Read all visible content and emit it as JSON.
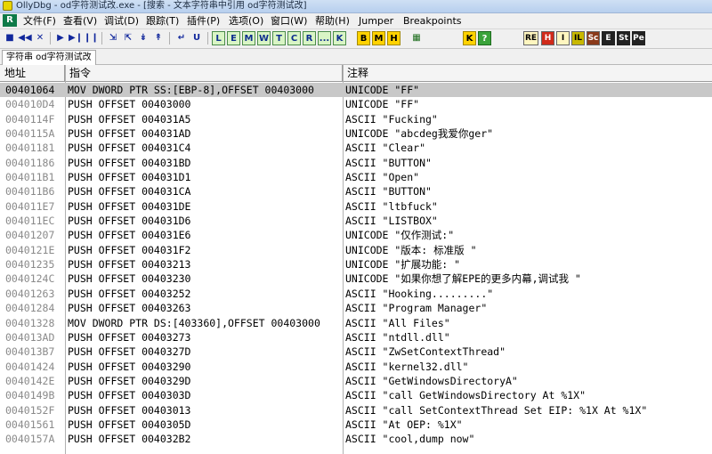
{
  "window": {
    "title": "OllyDbg - od字符测试改.exe - [搜索 - 文本字符串中引用 od字符测试改]"
  },
  "menubar": {
    "cpu_label": "R",
    "items": [
      "文件(F)",
      "查看(V)",
      "调试(D)",
      "跟踪(T)",
      "插件(P)",
      "选项(O)",
      "窗口(W)",
      "帮助(H)",
      "Jumper",
      "Breakpoints"
    ]
  },
  "toolbar": {
    "letters": [
      "L",
      "E",
      "M",
      "W",
      "T",
      "C",
      "R",
      "...",
      "K"
    ],
    "yellow": [
      "B",
      "M",
      "H"
    ],
    "k2": "K",
    "q": "?",
    "right": [
      "RE",
      "H",
      "I",
      "IL",
      "Sc",
      "E",
      "St",
      "Pe"
    ]
  },
  "tab": {
    "label": "字符串 od字符测试改"
  },
  "table": {
    "columns": [
      "地址",
      "指令",
      "注释"
    ],
    "rows": [
      {
        "addr": "00401064",
        "instr": "MOV DWORD PTR SS:[EBP-8],OFFSET 00403000",
        "note": "UNICODE \"FF\"",
        "selected": true
      },
      {
        "addr": "004010D4",
        "instr": "PUSH OFFSET 00403000",
        "note": "UNICODE \"FF\""
      },
      {
        "addr": "0040114F",
        "instr": "PUSH OFFSET 004031A5",
        "note": "ASCII \"Fucking\""
      },
      {
        "addr": "0040115A",
        "instr": "PUSH OFFSET 004031AD",
        "note": "UNICODE \"abcdeg我爱你ger\""
      },
      {
        "addr": "00401181",
        "instr": "PUSH OFFSET 004031C4",
        "note": "ASCII \"Clear\""
      },
      {
        "addr": "00401186",
        "instr": "PUSH OFFSET 004031BD",
        "note": "ASCII \"BUTTON\""
      },
      {
        "addr": "004011B1",
        "instr": "PUSH OFFSET 004031D1",
        "note": "ASCII \"Open\""
      },
      {
        "addr": "004011B6",
        "instr": "PUSH OFFSET 004031CA",
        "note": "ASCII \"BUTTON\""
      },
      {
        "addr": "004011E7",
        "instr": "PUSH OFFSET 004031DE",
        "note": "ASCII \"ltbfuck\""
      },
      {
        "addr": "004011EC",
        "instr": "PUSH OFFSET 004031D6",
        "note": "ASCII \"LISTBOX\""
      },
      {
        "addr": "00401207",
        "instr": "PUSH OFFSET 004031E6",
        "note": "UNICODE \"仅作测试:\""
      },
      {
        "addr": "0040121E",
        "instr": "PUSH OFFSET 004031F2",
        "note": "UNICODE \"版本: 标准版  \""
      },
      {
        "addr": "00401235",
        "instr": "PUSH OFFSET 00403213",
        "note": "UNICODE \"扩展功能:  \""
      },
      {
        "addr": "0040124C",
        "instr": "PUSH OFFSET 00403230",
        "note": "UNICODE \"如果你想了解EPE的更多内幕,调试我 \""
      },
      {
        "addr": "00401263",
        "instr": "PUSH OFFSET 00403252",
        "note": "ASCII \"Hooking.........\""
      },
      {
        "addr": "00401284",
        "instr": "PUSH OFFSET 00403263",
        "note": "ASCII \"Program Manager\""
      },
      {
        "addr": "00401328",
        "instr": "MOV DWORD PTR DS:[403360],OFFSET 00403000",
        "note": "ASCII \"All Files\""
      },
      {
        "addr": "004013AD",
        "instr": "PUSH OFFSET 00403273",
        "note": "ASCII \"ntdll.dll\""
      },
      {
        "addr": "004013B7",
        "instr": "PUSH OFFSET 0040327D",
        "note": "ASCII \"ZwSetContextThread\""
      },
      {
        "addr": "00401424",
        "instr": "PUSH OFFSET 00403290",
        "note": "ASCII \"kernel32.dll\""
      },
      {
        "addr": "0040142E",
        "instr": "PUSH OFFSET 0040329D",
        "note": "ASCII \"GetWindowsDirectoryA\""
      },
      {
        "addr": "0040149B",
        "instr": "PUSH OFFSET 0040303D",
        "note": "ASCII \"call GetWindowsDirectory At %1X\""
      },
      {
        "addr": "0040152F",
        "instr": "PUSH OFFSET 00403013",
        "note": "ASCII \"call SetContextThread Set EIP: %1X At %1X\""
      },
      {
        "addr": "00401561",
        "instr": "PUSH OFFSET 0040305D",
        "note": "ASCII \"At OEP: %1X\""
      },
      {
        "addr": "0040157A",
        "instr": "PUSH OFFSET 004032B2",
        "note": "ASCII \"cool,dump now\""
      }
    ]
  }
}
